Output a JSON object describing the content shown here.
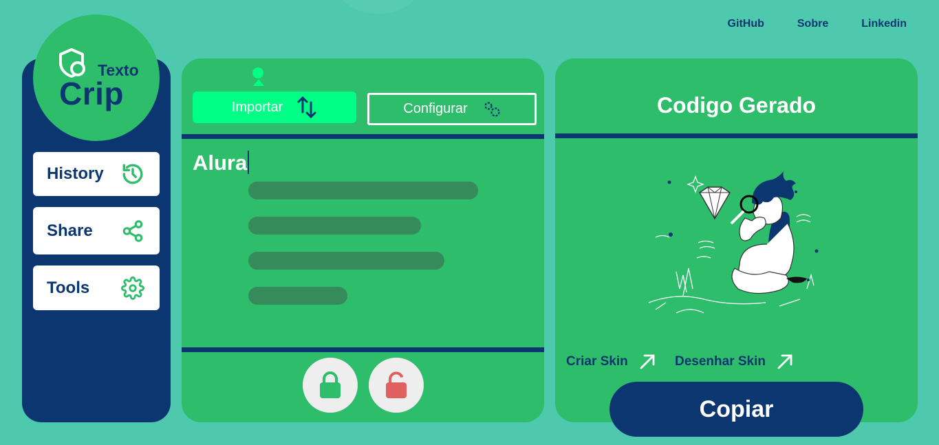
{
  "nav": {
    "links": [
      "GitHub",
      "Sobre",
      "Linkedin"
    ]
  },
  "logo": {
    "small": "Texto",
    "big": "Crip"
  },
  "sidebar": {
    "items": [
      {
        "label": "History",
        "icon": "history-icon"
      },
      {
        "label": "Share",
        "icon": "share-icon"
      },
      {
        "label": "Tools",
        "icon": "gear-icon"
      }
    ]
  },
  "editor": {
    "import_label": "Importar",
    "config_label": "Configurar",
    "text_value": "Alura",
    "encrypt_icon": "lock-closed-icon",
    "decrypt_icon": "lock-open-icon"
  },
  "output": {
    "title": "Codigo Gerado",
    "links": [
      "Criar Skin",
      "Desenhar Skin"
    ],
    "copy_label": "Copiar"
  },
  "colors": {
    "background": "#4ec9ae",
    "panel_green": "#2ebd6a",
    "navy": "#0b3670",
    "accent": "#00ff85",
    "lock_green": "#2ebd6a",
    "lock_red": "#e06060"
  }
}
